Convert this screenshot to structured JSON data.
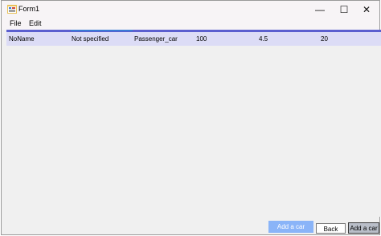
{
  "window": {
    "title": "Form1",
    "minimize_glyph": "—",
    "maximize_glyph": "☐",
    "close_glyph": "✕"
  },
  "menu": {
    "items": [
      "File",
      "Edit"
    ]
  },
  "grid": {
    "rows": [
      [
        "NoName",
        "Not specified",
        "Passenger_car",
        "100",
        "4.5",
        "20"
      ]
    ],
    "selected_row_color": "#dcdcf6",
    "border_color": "#5b5fcf"
  },
  "buttons": {
    "add_car_primary": "Add a car",
    "back": "Back",
    "add_car_secondary": "Add a car"
  },
  "icons": {
    "app": "form-app-icon"
  }
}
